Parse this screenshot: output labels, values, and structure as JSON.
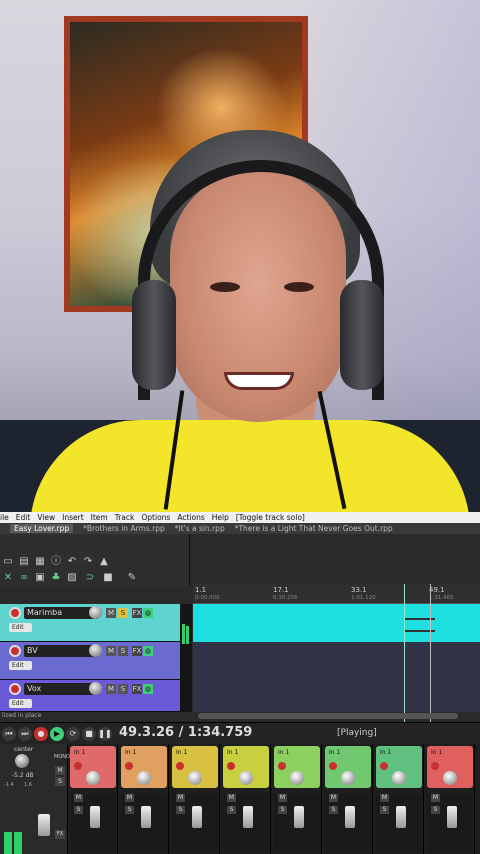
{
  "menubar": {
    "items": [
      "ile",
      "Edit",
      "View",
      "Insert",
      "Item",
      "Track",
      "Options",
      "Actions",
      "Help",
      "[Toggle track solo]"
    ]
  },
  "tabs": [
    {
      "label": "Easy Lover.rpp",
      "active": true
    },
    {
      "label": "*Brothers in Arms.rpp",
      "active": false
    },
    {
      "label": "*It's a sin.rpp",
      "active": false
    },
    {
      "label": "*There is a Light That Never Goes Out.rpp",
      "active": false
    }
  ],
  "ruler": {
    "marks": [
      "1.1",
      "17.1",
      "33.1",
      "49.1"
    ],
    "subs": [
      "0:00.000",
      "0:30.256",
      "1:01.120",
      "1:31.465"
    ]
  },
  "tracks": [
    {
      "name": "Marimba",
      "color": "#5fd4cf",
      "edit": "Edit"
    },
    {
      "name": "BV",
      "color": "#6a6ad0",
      "edit": "Edit"
    },
    {
      "name": "Vox",
      "color": "#6a5ad8",
      "edit": "Edit"
    }
  ],
  "statusbar": {
    "text": "lized in place"
  },
  "transport": {
    "time": "49.3.26 / 1:34.759",
    "status": "[Playing]"
  },
  "master": {
    "label": "center",
    "db": "-5.2 dB",
    "left": "-1.4",
    "right": "1.6",
    "mono": "MONO",
    "mute": "M",
    "solo": "S",
    "fx": "FX"
  },
  "mixer_strips": [
    {
      "input": "In 1",
      "color": "#e06a6a"
    },
    {
      "input": "In 1",
      "color": "#e0a060"
    },
    {
      "input": "In 1",
      "color": "#d8c040"
    },
    {
      "input": "In 1",
      "color": "#c8d040"
    },
    {
      "input": "In 1",
      "color": "#8cd060"
    },
    {
      "input": "In 1",
      "color": "#70c870"
    },
    {
      "input": "In 1",
      "color": "#60c080"
    },
    {
      "input": "In 1",
      "color": "#e06060"
    }
  ],
  "strip_labels": {
    "mute": "M",
    "solo": "S"
  }
}
